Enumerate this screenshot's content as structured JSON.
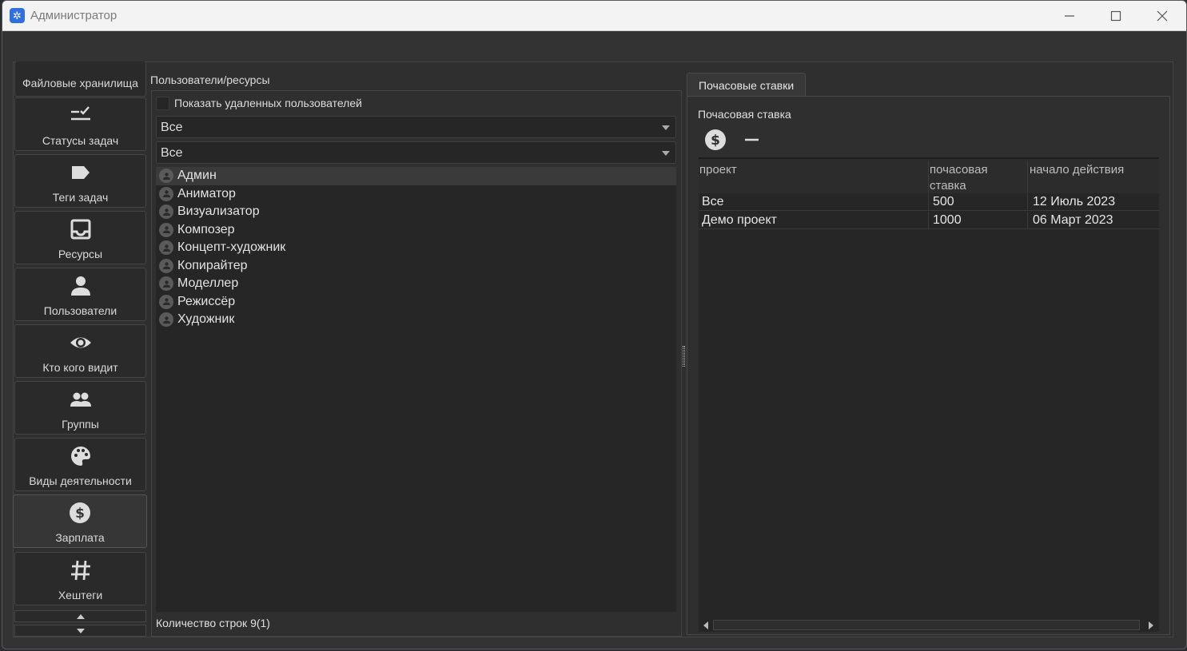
{
  "window": {
    "title": "Администратор"
  },
  "nav": {
    "items": [
      {
        "label": "Файловые хранилища",
        "icon": "storage-icon"
      },
      {
        "label": "Статусы задач",
        "icon": "task-status-icon"
      },
      {
        "label": "Теги задач",
        "icon": "tag-icon"
      },
      {
        "label": "Ресурсы",
        "icon": "inbox-icon"
      },
      {
        "label": "Пользователи",
        "icon": "person-icon"
      },
      {
        "label": "Кто кого видит",
        "icon": "eye-icon"
      },
      {
        "label": "Группы",
        "icon": "group-icon"
      },
      {
        "label": "Виды деятельности",
        "icon": "palette-icon"
      },
      {
        "label": "Зарплата",
        "icon": "dollar-icon",
        "active": true
      },
      {
        "label": "Хештеги",
        "icon": "hashtag-icon"
      }
    ]
  },
  "users_panel": {
    "title": "Пользователи/ресурсы",
    "show_deleted_label": "Показать удаленных пользователей",
    "show_deleted_checked": false,
    "filter1": "Все",
    "filter2": "Все",
    "users": [
      "Админ",
      "Аниматор",
      "Визуализатор",
      "Композер",
      "Концепт-художник",
      "Копирайтер",
      "Моделлер",
      "Режиссёр",
      "Художник"
    ],
    "selected_user": "Админ",
    "row_count": "Количество строк 9(1)"
  },
  "rates_panel": {
    "tab_label": "Почасовые ставки",
    "section_title": "Почасовая ставка",
    "columns": [
      "проект",
      "почасовая ставка",
      "начало действия"
    ],
    "rows": [
      {
        "project": "Все",
        "rate": "500",
        "start": "12 Июль 2023"
      },
      {
        "project": "Демо проект",
        "rate": "1000",
        "start": "06 Март 2023"
      }
    ]
  },
  "colors": {
    "background": "#333333",
    "panel": "#2f2f2f",
    "list_bg": "#262626",
    "selected_row": "#3a3a3a",
    "text": "#e6e6e6"
  }
}
